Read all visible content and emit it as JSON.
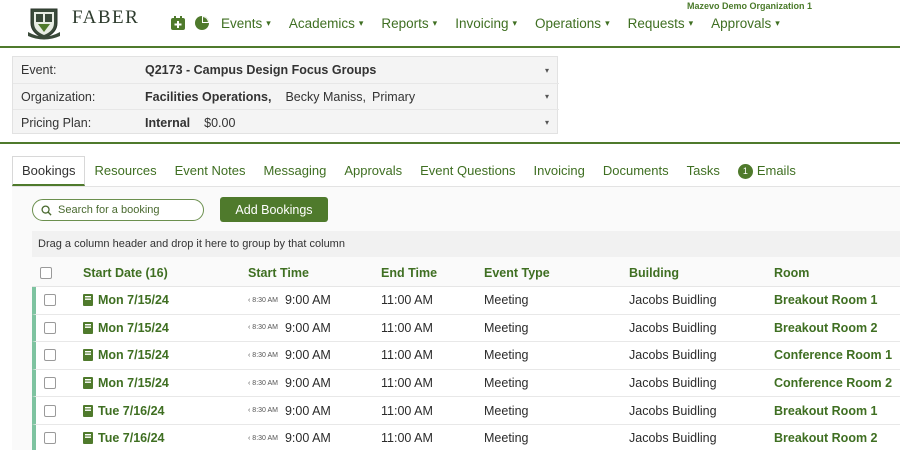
{
  "app": {
    "brand": "FABER",
    "org_name": "Mazevo Demo Organization 1"
  },
  "nav": {
    "items": [
      {
        "label": "Events"
      },
      {
        "label": "Academics"
      },
      {
        "label": "Reports"
      },
      {
        "label": "Invoicing"
      },
      {
        "label": "Operations"
      },
      {
        "label": "Requests"
      },
      {
        "label": "Approvals"
      }
    ],
    "caret": "▾"
  },
  "event": {
    "event_label": "Event:",
    "event_value": "Q2173 - Campus Design Focus Groups",
    "org_label": "Organization:",
    "org_value": "Facilities Operations,",
    "contact_name": "Becky Maniss,",
    "contact_role": "Primary",
    "pricing_label": "Pricing Plan:",
    "pricing_value": "Internal",
    "pricing_amount": "$0.00",
    "caret": "▾"
  },
  "tabs": [
    {
      "label": "Bookings",
      "active": true
    },
    {
      "label": "Resources"
    },
    {
      "label": "Event Notes"
    },
    {
      "label": "Messaging"
    },
    {
      "label": "Approvals"
    },
    {
      "label": "Event Questions"
    },
    {
      "label": "Invoicing"
    },
    {
      "label": "Documents"
    },
    {
      "label": "Tasks"
    },
    {
      "label": "Emails",
      "badge": "1"
    }
  ],
  "toolbar": {
    "search_placeholder": "Search for a booking",
    "add_label": "Add Bookings",
    "group_hint": "Drag a column header and drop it here to group by that column"
  },
  "table": {
    "headers": {
      "start_date": "Start Date (16)",
      "start_time": "Start Time",
      "end_time": "End Time",
      "event_type": "Event Type",
      "building": "Building",
      "room": "Room"
    },
    "rows": [
      {
        "date": "Mon 7/15/24",
        "prev_time": "8:30 AM",
        "start": "9:00 AM",
        "end": "11:00 AM",
        "type": "Meeting",
        "building": "Jacobs Buidling",
        "room": "Breakout Room 1"
      },
      {
        "date": "Mon 7/15/24",
        "prev_time": "8:30 AM",
        "start": "9:00 AM",
        "end": "11:00 AM",
        "type": "Meeting",
        "building": "Jacobs Buidling",
        "room": "Breakout Room 2"
      },
      {
        "date": "Mon 7/15/24",
        "prev_time": "8:30 AM",
        "start": "9:00 AM",
        "end": "11:00 AM",
        "type": "Meeting",
        "building": "Jacobs Buidling",
        "room": "Conference Room 1"
      },
      {
        "date": "Mon 7/15/24",
        "prev_time": "8:30 AM",
        "start": "9:00 AM",
        "end": "11:00 AM",
        "type": "Meeting",
        "building": "Jacobs Buidling",
        "room": "Conference Room 2"
      },
      {
        "date": "Tue 7/16/24",
        "prev_time": "8:30 AM",
        "start": "9:00 AM",
        "end": "11:00 AM",
        "type": "Meeting",
        "building": "Jacobs Buidling",
        "room": "Breakout Room 1"
      },
      {
        "date": "Tue 7/16/24",
        "prev_time": "8:30 AM",
        "start": "9:00 AM",
        "end": "11:00 AM",
        "type": "Meeting",
        "building": "Jacobs Buidling",
        "room": "Breakout Room 2"
      }
    ]
  },
  "colors": {
    "accent": "#4f7a2c",
    "link": "#3f6f22",
    "row_marker": "#7ec3a0"
  }
}
